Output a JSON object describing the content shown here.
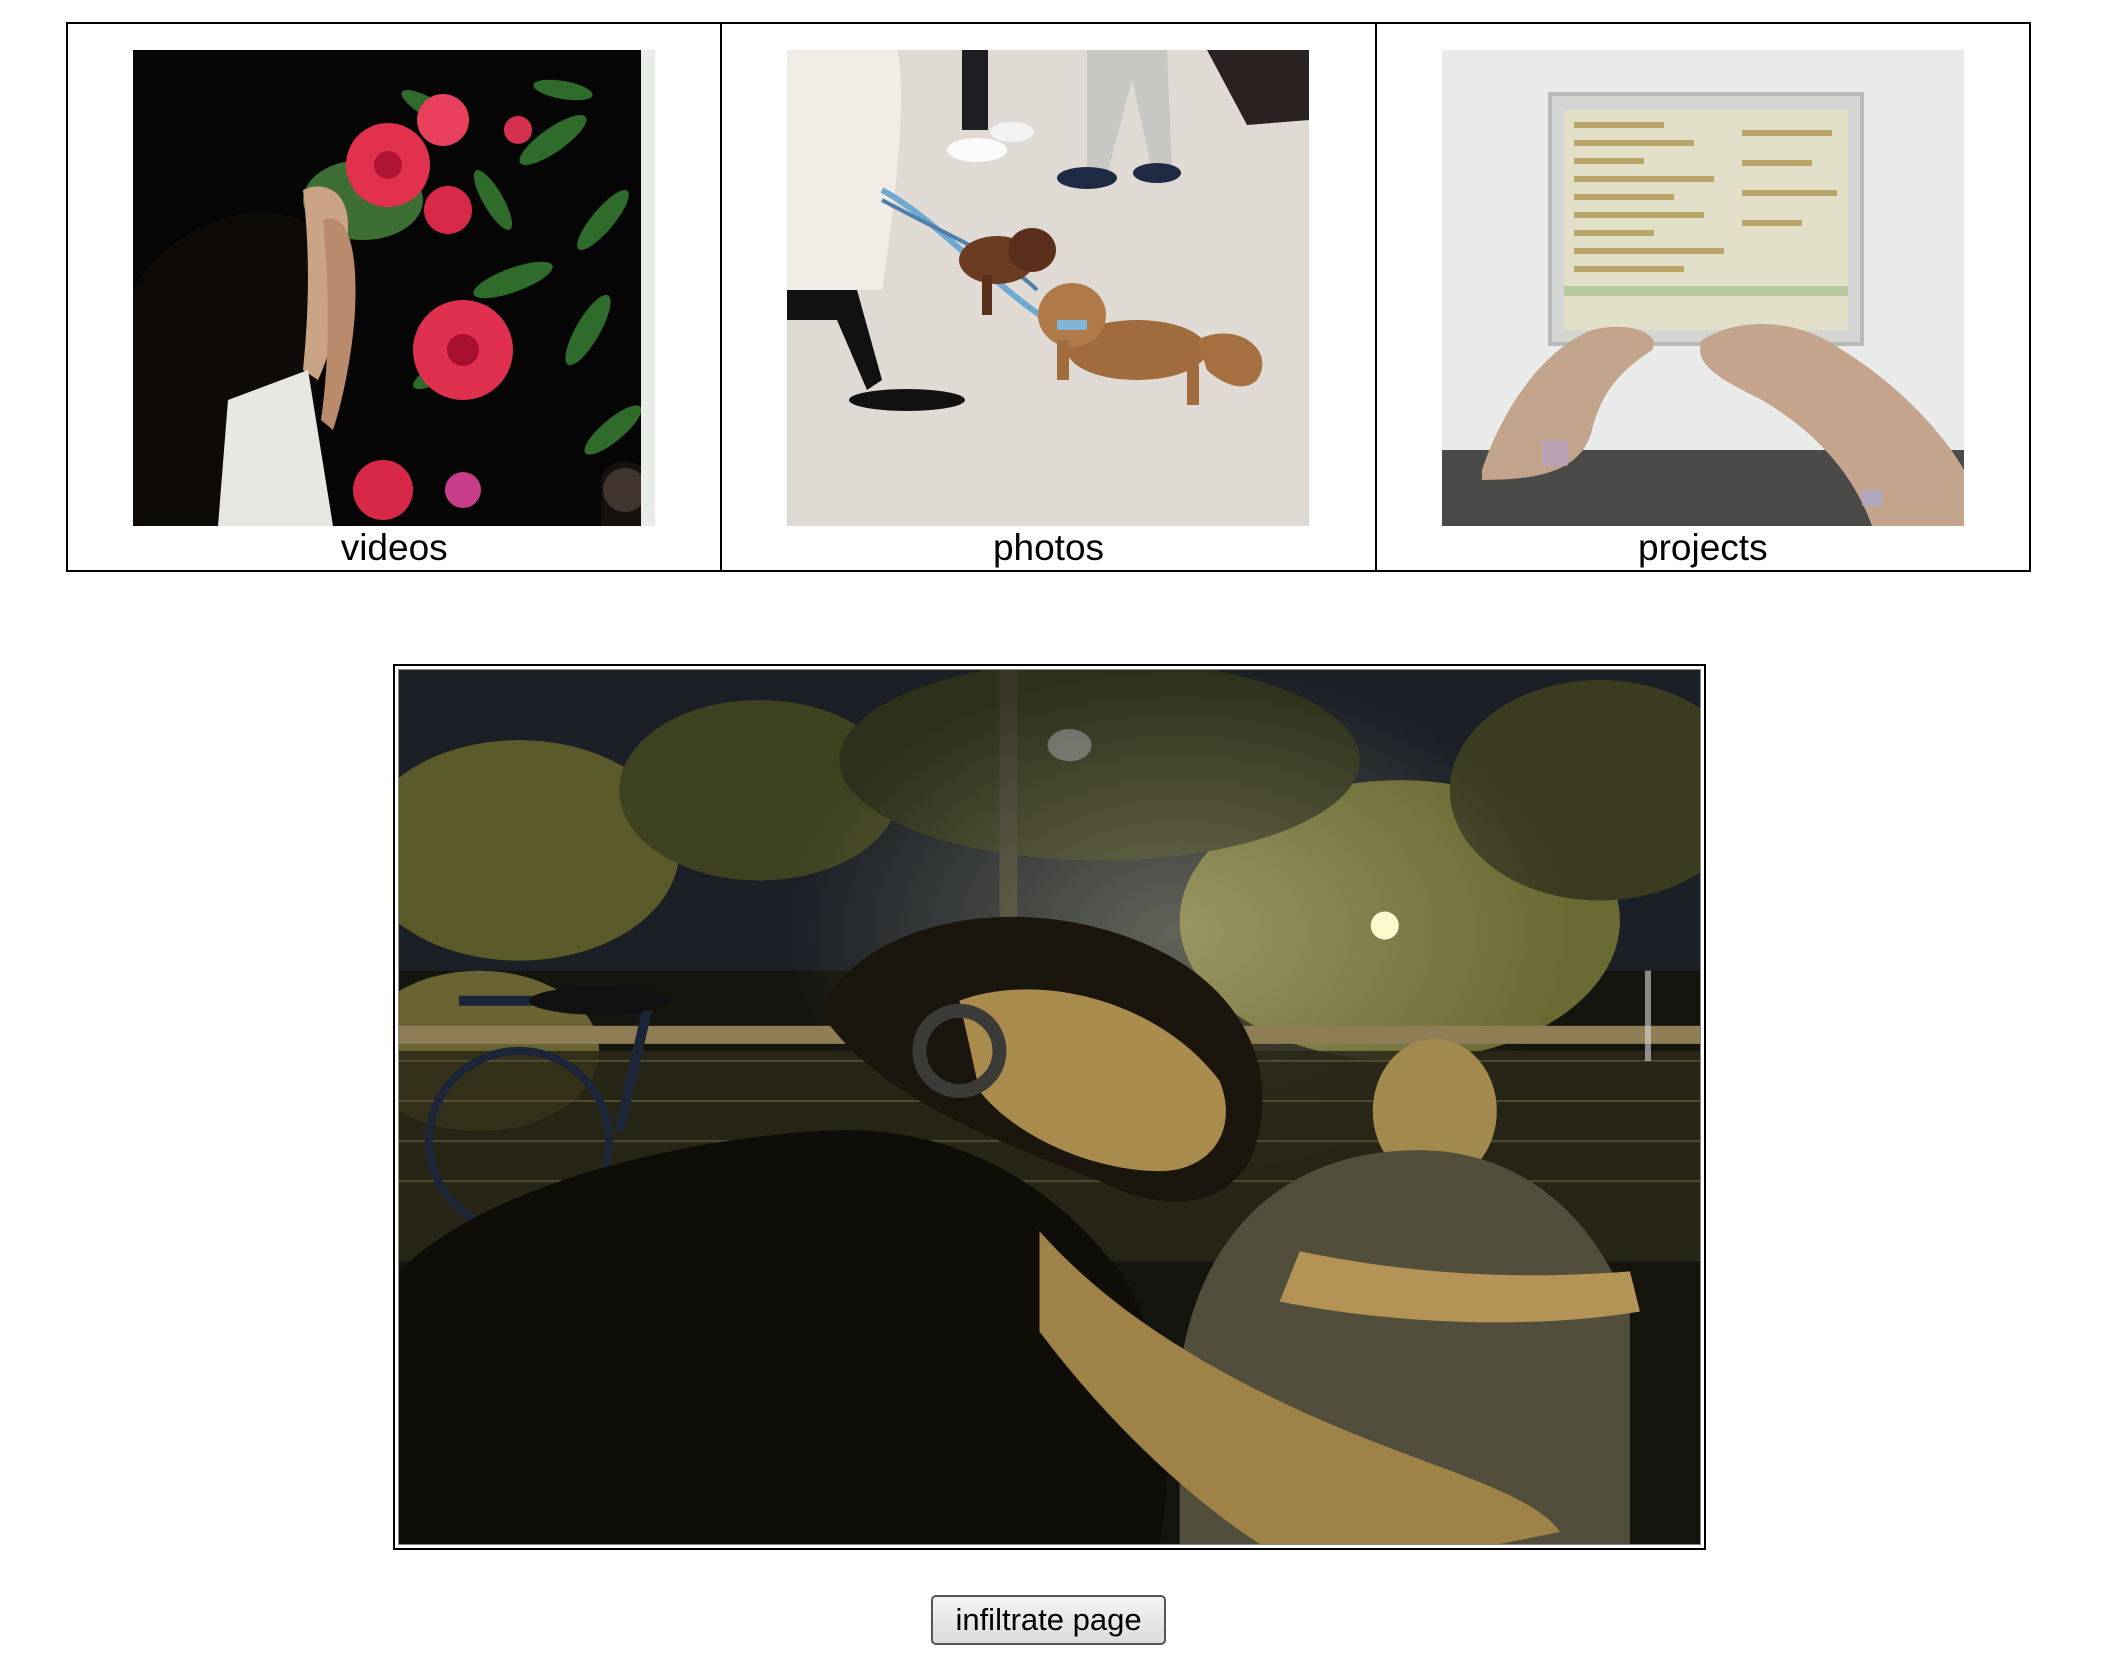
{
  "nav": {
    "items": [
      {
        "label": "videos",
        "image": "video-still-thumbnail"
      },
      {
        "label": "photos",
        "image": "dogs-photo-thumbnail"
      },
      {
        "label": "projects",
        "image": "laptop-typing-thumbnail"
      }
    ]
  },
  "featured": {
    "image": "night-park-photo"
  },
  "actions": {
    "infiltrate_label": "infiltrate page"
  },
  "colors": {
    "border": "#000000",
    "button_bg": "#e6e6e6"
  }
}
